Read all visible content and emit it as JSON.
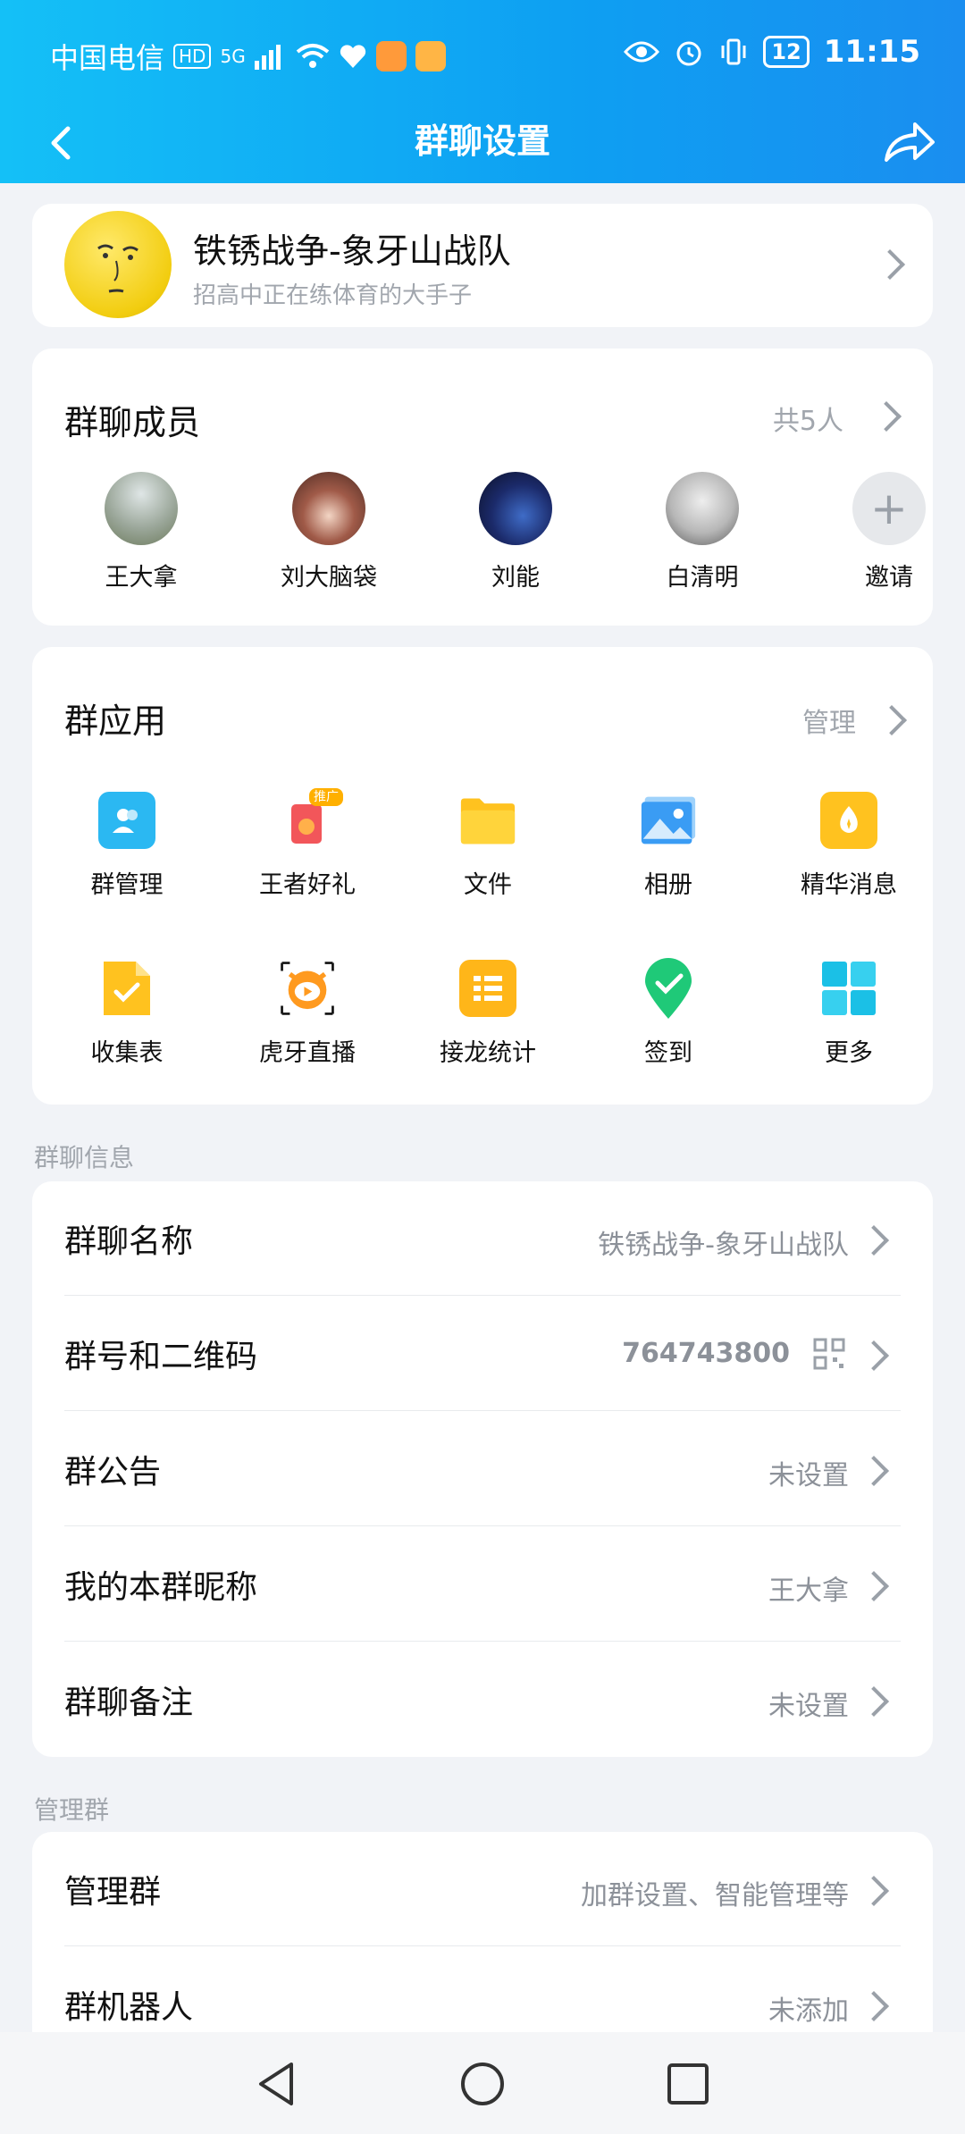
{
  "status_bar": {
    "carrier": "中国电信",
    "hd": "HD",
    "network": "5G",
    "battery": "12",
    "time": "11:15"
  },
  "header": {
    "title": "群聊设置"
  },
  "group": {
    "name": "铁锈战争-象牙山战队",
    "description": "招高中正在练体育的大手子"
  },
  "members": {
    "title": "群聊成员",
    "count": "共5人",
    "list": [
      {
        "name": "王大拿"
      },
      {
        "name": "刘大脑袋"
      },
      {
        "name": "刘能"
      },
      {
        "name": "白清明"
      },
      {
        "name": "邀请"
      }
    ]
  },
  "apps": {
    "title": "群应用",
    "manage": "管理",
    "items": [
      {
        "label": "群管理",
        "icon": "group-manage-icon"
      },
      {
        "label": "王者好礼",
        "icon": "gift-icon"
      },
      {
        "label": "文件",
        "icon": "folder-icon"
      },
      {
        "label": "相册",
        "icon": "album-icon"
      },
      {
        "label": "精华消息",
        "icon": "essence-icon"
      },
      {
        "label": "收集表",
        "icon": "form-icon"
      },
      {
        "label": "虎牙直播",
        "icon": "huya-icon"
      },
      {
        "label": "接龙统计",
        "icon": "relay-icon"
      },
      {
        "label": "签到",
        "icon": "checkin-icon"
      },
      {
        "label": "更多",
        "icon": "more-grid-icon"
      }
    ],
    "badge": "推广"
  },
  "info_section": {
    "label": "群聊信息",
    "rows": [
      {
        "label": "群聊名称",
        "value": "铁锈战争-象牙山战队"
      },
      {
        "label": "群号和二维码",
        "value": "764743800"
      },
      {
        "label": "群公告",
        "value": "未设置"
      },
      {
        "label": "我的本群昵称",
        "value": "王大拿"
      },
      {
        "label": "群聊备注",
        "value": "未设置"
      }
    ]
  },
  "manage_section": {
    "label": "管理群",
    "rows": [
      {
        "label": "管理群",
        "value": "加群设置、智能管理等"
      },
      {
        "label": "群机器人",
        "value": "未添加"
      }
    ]
  },
  "colors": {
    "header_start": "#14c0f7",
    "header_end": "#1a8ef0",
    "background": "#f1f3f7"
  }
}
